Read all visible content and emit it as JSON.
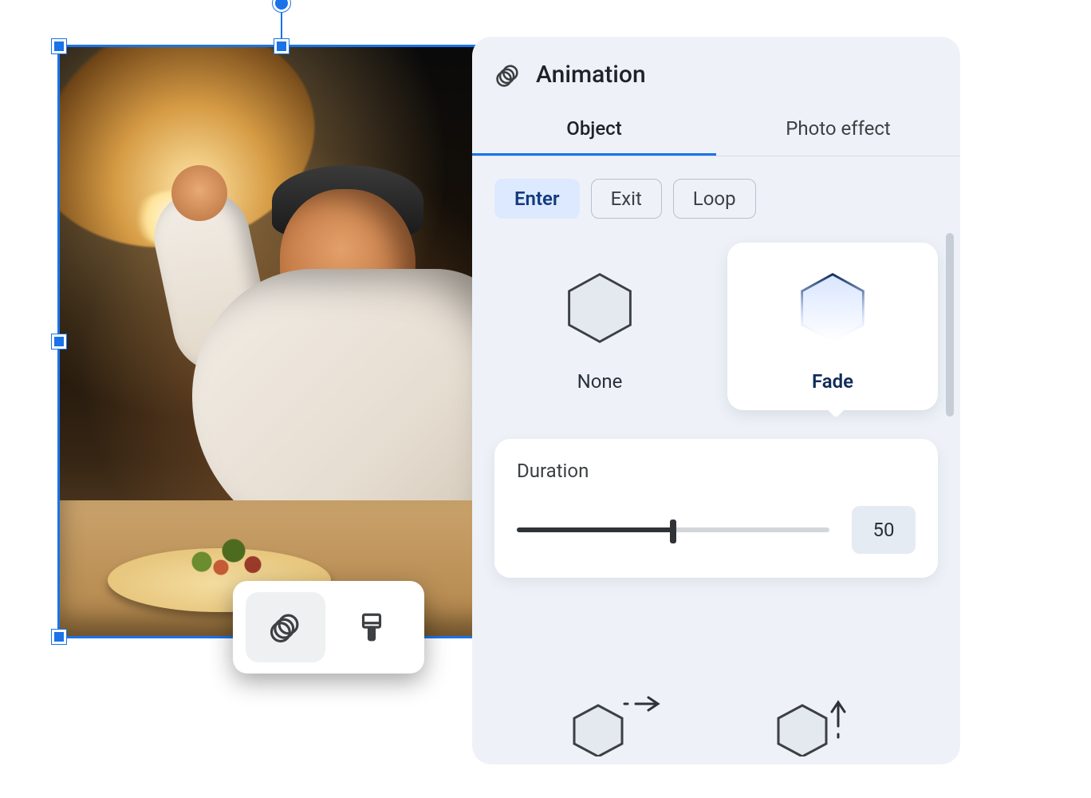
{
  "panel": {
    "title": "Animation",
    "tabs": {
      "object": "Object",
      "photo_effect": "Photo effect",
      "active": "object"
    },
    "chips": {
      "enter": "Enter",
      "exit": "Exit",
      "loop": "Loop",
      "active": "enter"
    },
    "options": {
      "none": "None",
      "fade": "Fade",
      "selected": "fade"
    },
    "duration": {
      "label": "Duration",
      "value": "50",
      "percent": 50
    }
  },
  "mini_toolbar": {
    "active": "animation"
  },
  "colors": {
    "accent": "#1a73e8",
    "panel_bg": "#eef2f8",
    "chip_active_bg": "#dde9ff"
  }
}
